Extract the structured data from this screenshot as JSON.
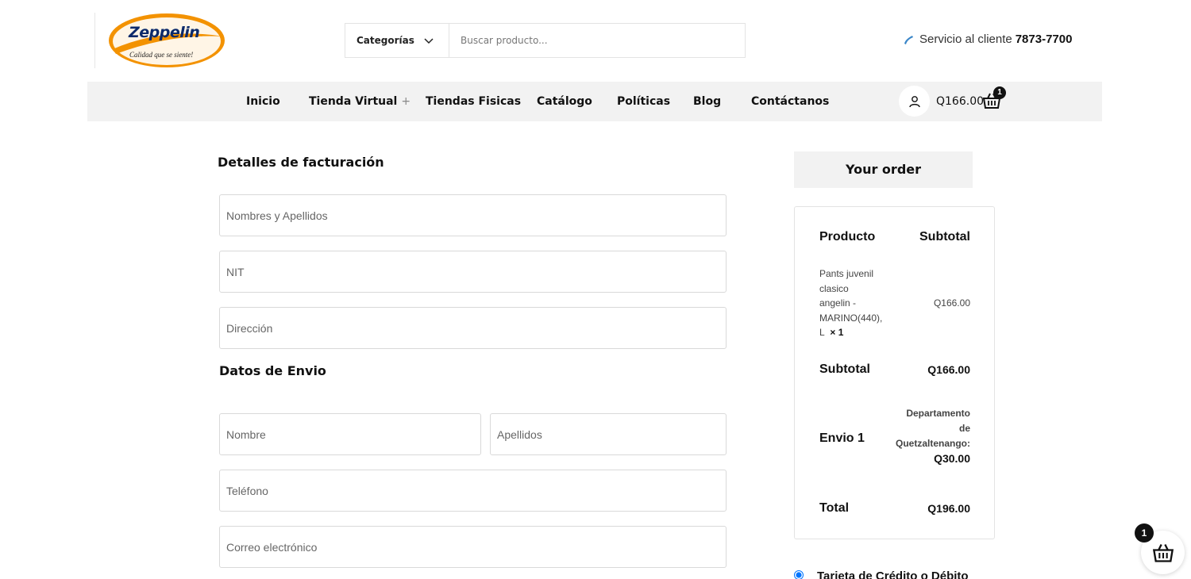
{
  "brand": {
    "name": "Zeppelin",
    "tagline": "Calidad que se siente!",
    "colors": {
      "orange": "#f39200",
      "navy": "#0c2a6b"
    }
  },
  "search": {
    "category_label": "Categorías",
    "placeholder": "Buscar producto..."
  },
  "service": {
    "label": "Servicio al cliente",
    "phone": "7873-7700"
  },
  "nav": {
    "items": [
      "Inicio",
      "Tienda Virtual",
      "Tiendas Fisicas",
      "Catálogo",
      "Políticas",
      "Blog",
      "Contáctanos"
    ],
    "tienda_plus": "+",
    "cart_total": "Q166.00",
    "cart_count": "1"
  },
  "billing": {
    "title": "Detalles de facturación",
    "placeholders": {
      "nombres": "Nombres y Apellidos",
      "nit": "NIT",
      "direccion": "Dirección"
    }
  },
  "shipping": {
    "title": "Datos de Envio",
    "placeholders": {
      "nombre": "Nombre",
      "apellidos": "Apellidos",
      "telefono": "Teléfono",
      "correo": "Correo electrónico"
    }
  },
  "order": {
    "title": "Your order",
    "col_product": "Producto",
    "col_subtotal": "Subtotal",
    "product": {
      "lines": [
        "Pants juvenil",
        "clasico",
        "angelin -",
        "MARINO(440),",
        "L"
      ],
      "qty": "× 1",
      "price": "Q166.00"
    },
    "subtotal_label": "Subtotal",
    "subtotal_value": "Q166.00",
    "shipping_label": "Envio 1",
    "shipping_dest_lines": [
      "Departamento",
      "de",
      "Quetzaltenango:"
    ],
    "shipping_value": "Q30.00",
    "total_label": "Total",
    "total_value": "Q196.00"
  },
  "payment": {
    "option": "Tarjeta de Crédito o Débito"
  },
  "floating_cart": {
    "count": "1"
  }
}
